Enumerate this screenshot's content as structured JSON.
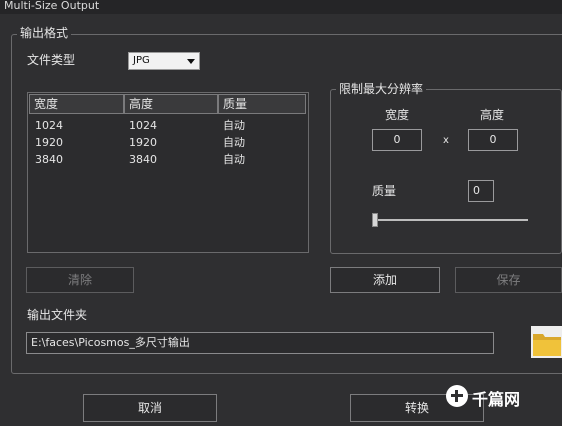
{
  "window": {
    "title": "Multi-Size Output"
  },
  "output_format": {
    "group_title": "输出格式",
    "file_type_label": "文件类型",
    "file_type_value": "JPG",
    "table": {
      "columns": [
        "宽度",
        "高度",
        "质量"
      ],
      "rows": [
        [
          "1024",
          "1024",
          "自动"
        ],
        [
          "1920",
          "1920",
          "自动"
        ],
        [
          "3840",
          "3840",
          "自动"
        ]
      ]
    },
    "clear_button": "清除"
  },
  "limit": {
    "group_title": "限制最大分辨率",
    "width_label": "宽度",
    "height_label": "高度",
    "width_value": "0",
    "height_value": "0",
    "times": "x",
    "quality_label": "质量",
    "quality_value": "0",
    "quality_level": 0
  },
  "actions": {
    "add": "添加",
    "save": "保存"
  },
  "output_folder": {
    "label": "输出文件夹",
    "path": "E:\\faces\\Picosmos_多尺寸输出"
  },
  "footer": {
    "cancel": "取消",
    "convert": "转换"
  },
  "watermark": {
    "text": "千篇网"
  },
  "colors": {
    "background": "#2f2f31",
    "folder": "#f0c23a"
  }
}
